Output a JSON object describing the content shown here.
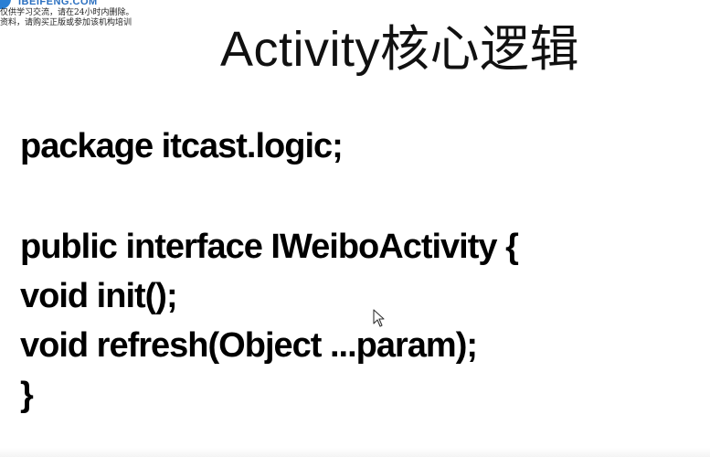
{
  "watermark": {
    "brand": "IBEIFENG.COM",
    "line1": "仅供学习交流，请在24小时内删除。",
    "line2": "资料，请购买正版或参加该机构培训"
  },
  "slide": {
    "title": "Activity核心逻辑",
    "code": {
      "package_line": "package itcast.logic;",
      "interface_line": "public interface IWeiboActivity {",
      "init_line": "void init();",
      "refresh_line": "void refresh(Object ...param);",
      "closing_brace": "}"
    }
  },
  "icons": {
    "cursor": "mouse-pointer-icon"
  }
}
